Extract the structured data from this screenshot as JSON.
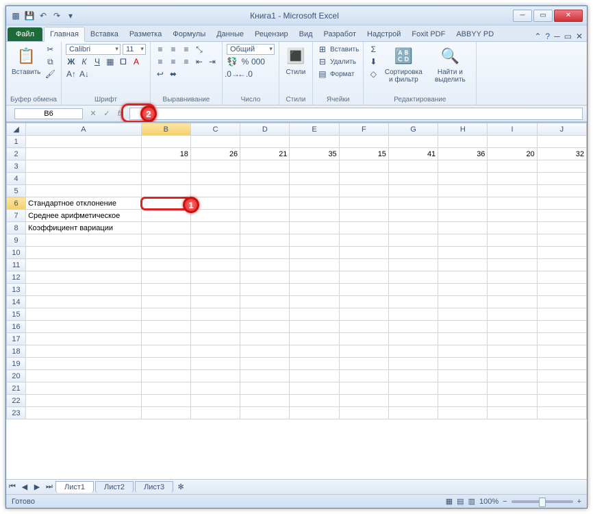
{
  "window": {
    "title": "Книга1 - Microsoft Excel"
  },
  "qat": {
    "save": "💾",
    "undo": "↶",
    "redo": "↷"
  },
  "tabs": {
    "file": "Файл",
    "home": "Главная",
    "insert": "Вставка",
    "layout": "Разметка",
    "formulas": "Формулы",
    "data": "Данные",
    "review": "Рецензир",
    "view": "Вид",
    "dev": "Разработ",
    "addin": "Надстрой",
    "foxit": "Foxit PDF",
    "abbyy": "ABBYY PD"
  },
  "ribbon": {
    "clipboard": {
      "label": "Буфер обмена",
      "paste": "Вставить"
    },
    "font": {
      "label": "Шрифт",
      "name": "Calibri",
      "size": "11"
    },
    "align": {
      "label": "Выравнивание"
    },
    "number": {
      "label": "Число",
      "format": "Общий"
    },
    "styles": {
      "label": "Стили",
      "btn": "Стили"
    },
    "cells": {
      "label": "Ячейки",
      "insert": "Вставить",
      "delete": "Удалить",
      "format": "Формат"
    },
    "editing": {
      "label": "Редактирование",
      "sort": "Сортировка и фильтр",
      "find": "Найти и выделить"
    }
  },
  "namebox": "B6",
  "callouts": {
    "c1": "1",
    "c2": "2"
  },
  "columns": [
    "",
    "A",
    "B",
    "C",
    "D",
    "E",
    "F",
    "G",
    "H",
    "I",
    "J"
  ],
  "cells": {
    "r2": {
      "B": "18",
      "C": "26",
      "D": "21",
      "E": "35",
      "F": "15",
      "G": "41",
      "H": "36",
      "I": "20",
      "J": "32"
    },
    "r6": {
      "A": "Стандартное отклонение"
    },
    "r7": {
      "A": "Среднее арифметическое"
    },
    "r8": {
      "A": "Коэффициент вариации"
    }
  },
  "sheets": {
    "s1": "Лист1",
    "s2": "Лист2",
    "s3": "Лист3"
  },
  "status": {
    "ready": "Готово",
    "zoom": "100%"
  }
}
